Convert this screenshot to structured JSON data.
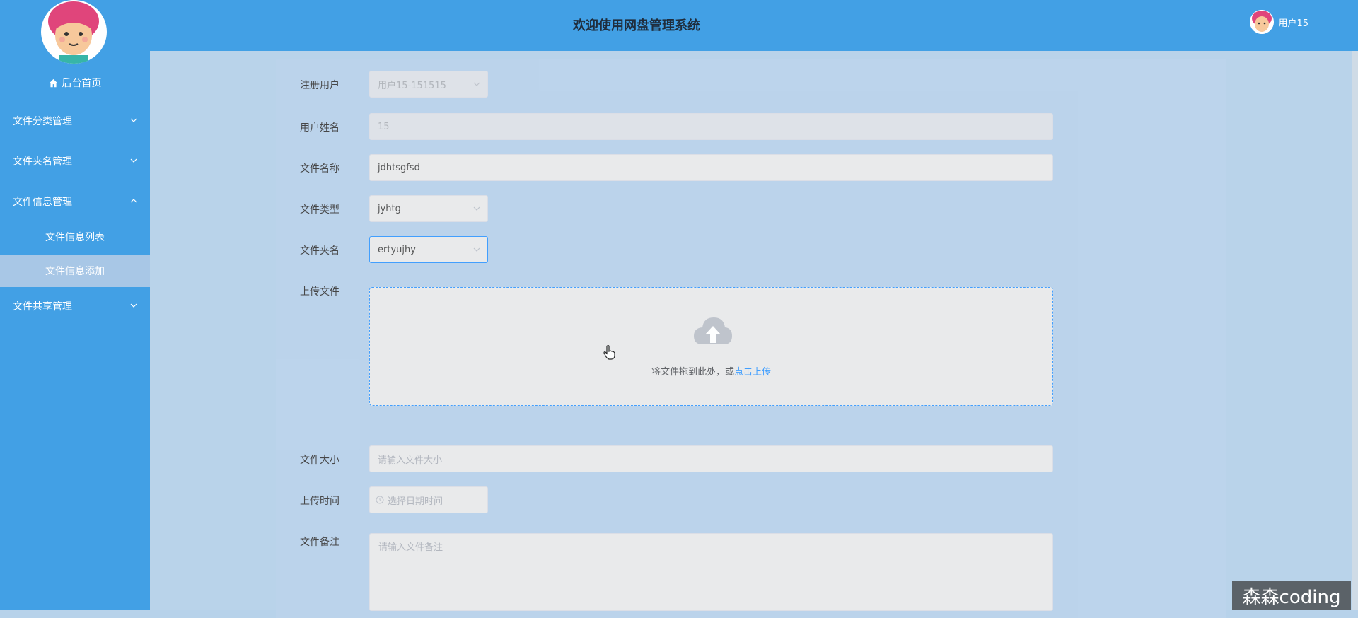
{
  "header": {
    "title": "欢迎使用网盘管理系统",
    "username": "用户15"
  },
  "sidebar": {
    "home_label": "后台首页",
    "menus": [
      {
        "label": "文件分类管理",
        "expanded": false
      },
      {
        "label": "文件夹名管理",
        "expanded": false
      },
      {
        "label": "文件信息管理",
        "expanded": true
      },
      {
        "label": "文件共享管理",
        "expanded": false
      }
    ],
    "submenus": [
      {
        "label": "文件信息列表",
        "active": false
      },
      {
        "label": "文件信息添加",
        "active": true
      }
    ]
  },
  "form": {
    "user": {
      "label": "注册用户",
      "value": "用户15-151515"
    },
    "user_name": {
      "label": "用户姓名",
      "value": "15"
    },
    "file_name": {
      "label": "文件名称",
      "value": "jdhtsgfsd"
    },
    "file_type": {
      "label": "文件类型",
      "value": "jyhtg"
    },
    "folder_name": {
      "label": "文件夹名",
      "value": "ertyujhy"
    },
    "upload": {
      "label": "上传文件",
      "hint": "将文件拖到此处，或",
      "link": "点击上传"
    },
    "file_size": {
      "label": "文件大小",
      "placeholder": "请输入文件大小"
    },
    "upload_time": {
      "label": "上传时间",
      "placeholder": "选择日期时间"
    },
    "remark": {
      "label": "文件备注",
      "placeholder": "请输入文件备注"
    }
  },
  "watermark": "森森coding",
  "colors": {
    "primary": "#42a0e5",
    "link": "#409eff"
  }
}
